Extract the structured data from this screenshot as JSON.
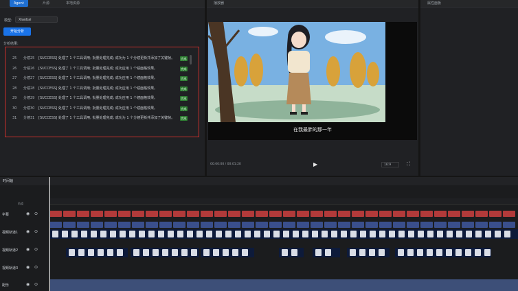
{
  "left_panel": {
    "tabs": [
      "Agent",
      "片源",
      "本地资源"
    ],
    "model_label": "模型:",
    "model_value": "Xiaobai",
    "start_button": "开始分析",
    "log_title": "分析结果:",
    "logs": [
      {
        "idx": "25",
        "seg": "分镜25",
        "msg": "[SUCCESS] 处理了 1 个工具调用; 批量处理完成; 成功为 1 个分镜更新并添加了关键帧。",
        "status": "完成"
      },
      {
        "idx": "26",
        "seg": "分镜26",
        "msg": "[SUCCESS] 处理了 1 个工具调用; 批量处理完成; 成功应用 1 个镜面格效果。",
        "status": "完成"
      },
      {
        "idx": "27",
        "seg": "分镜27",
        "msg": "[SUCCESS] 处理了 1 个工具调用; 批量处理完成; 成功应用 1 个镜面格效果。",
        "status": "完成"
      },
      {
        "idx": "28",
        "seg": "分镜28",
        "msg": "[SUCCESS] 处理了 1 个工具调用; 批量处理完成; 成功应用 1 个镜面格效果。",
        "status": "完成"
      },
      {
        "idx": "29",
        "seg": "分镜29",
        "msg": "[SUCCESS] 处理了 1 个工具调用; 批量处理完成; 成功应用 1 个镜面格效果。",
        "status": "完成"
      },
      {
        "idx": "30",
        "seg": "分镜30",
        "msg": "[SUCCESS] 处理了 1 个工具调用; 批量处理完成; 成功应用 1 个镜面格效果。",
        "status": "完成"
      },
      {
        "idx": "31",
        "seg": "分镜31",
        "msg": "[SUCCESS] 处理了 1 个工具调用; 批量处理完成; 成功为 1 个分镜更新并添加了关键帧。",
        "status": "完成"
      }
    ]
  },
  "preview": {
    "title": "播放器",
    "subtitle": "在我最胖的那一年",
    "time": "00:00:00 / 00:01:20",
    "ratio": "16:9",
    "colors": {
      "sky": "#6fa8dc",
      "ground": "#cfe3d0"
    }
  },
  "right_panel": {
    "title": "属性面板"
  },
  "timeline": {
    "title": "时间轴",
    "label_col_header": "轨道",
    "tracks": [
      {
        "name": "字幕"
      },
      {
        "name": "视频轨道1"
      },
      {
        "name": "视频轨道2"
      },
      {
        "name": "视频轨道3"
      },
      {
        "name": "配乐"
      }
    ]
  }
}
